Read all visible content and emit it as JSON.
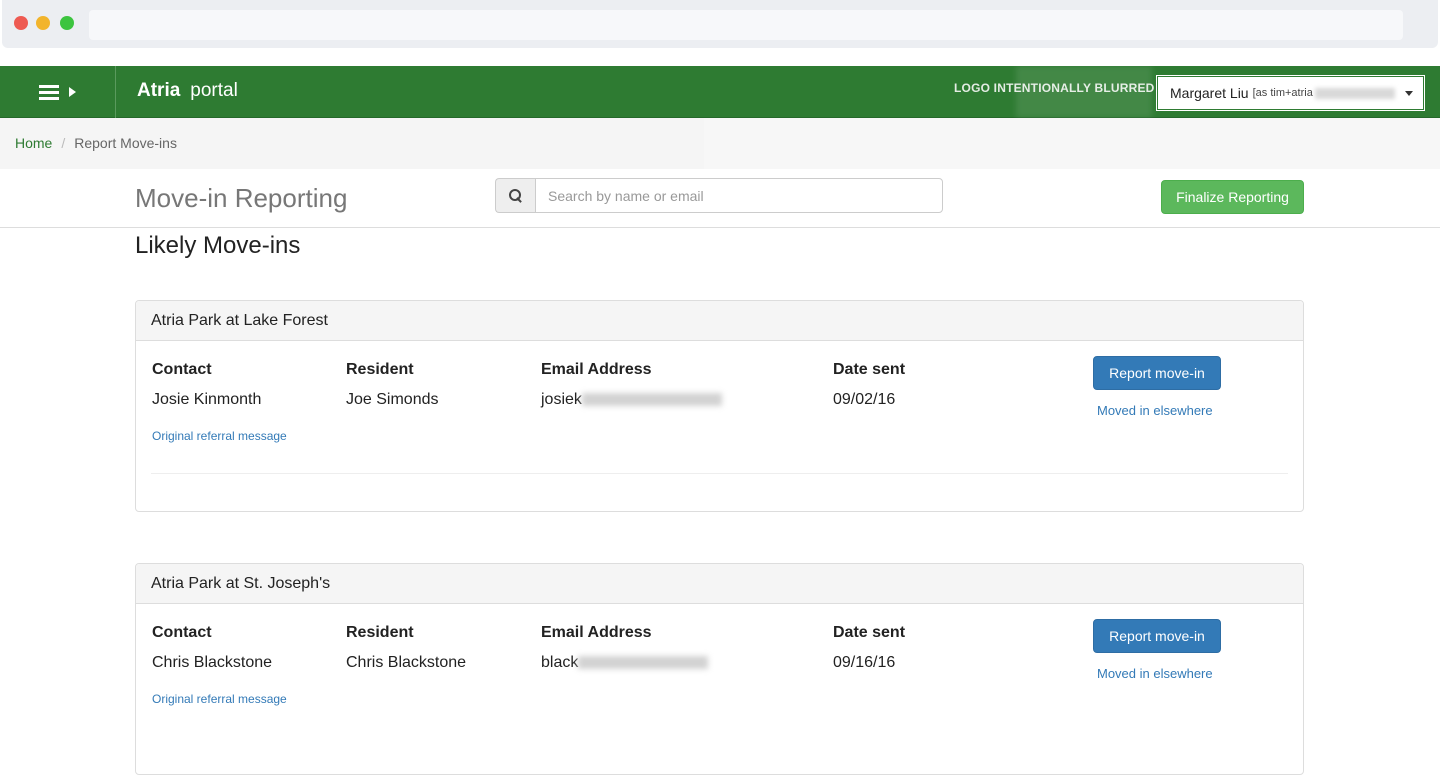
{
  "navbar": {
    "brand_bold": "Atria",
    "brand_sub": "portal",
    "logo_text": "LOGO INTENTIONALLY BLURRED",
    "user_name": "Margaret Liu",
    "user_as": "[as tim+atria"
  },
  "breadcrumb": {
    "home": "Home",
    "separator": "/",
    "current": "Report Move-ins"
  },
  "header": {
    "title": "Move-in Reporting",
    "search_placeholder": "Search by name or email",
    "finalize_label": "Finalize Reporting"
  },
  "section_title": "Likely Move-ins",
  "columns": {
    "contact": "Contact",
    "resident": "Resident",
    "email": "Email Address",
    "date": "Date sent"
  },
  "panels": [
    {
      "community": "Atria Park at Lake Forest",
      "contact": "Josie Kinmonth",
      "resident": "Joe Simonds",
      "email_visible": "josiek",
      "date_sent": "09/02/16",
      "referral_link": "Original referral message",
      "report_label": "Report move-in",
      "moved_label": "Moved in elsewhere"
    },
    {
      "community": "Atria Park at St. Joseph's",
      "contact": "Chris Blackstone",
      "resident": "Chris Blackstone",
      "email_visible": "black",
      "date_sent": "09/16/16",
      "referral_link": "Original referral message",
      "report_label": "Report move-in",
      "moved_label": "Moved in elsewhere"
    }
  ],
  "colors": {
    "navbar": "#2e7b32",
    "primary": "#337ab7",
    "success": "#5cb85c"
  }
}
